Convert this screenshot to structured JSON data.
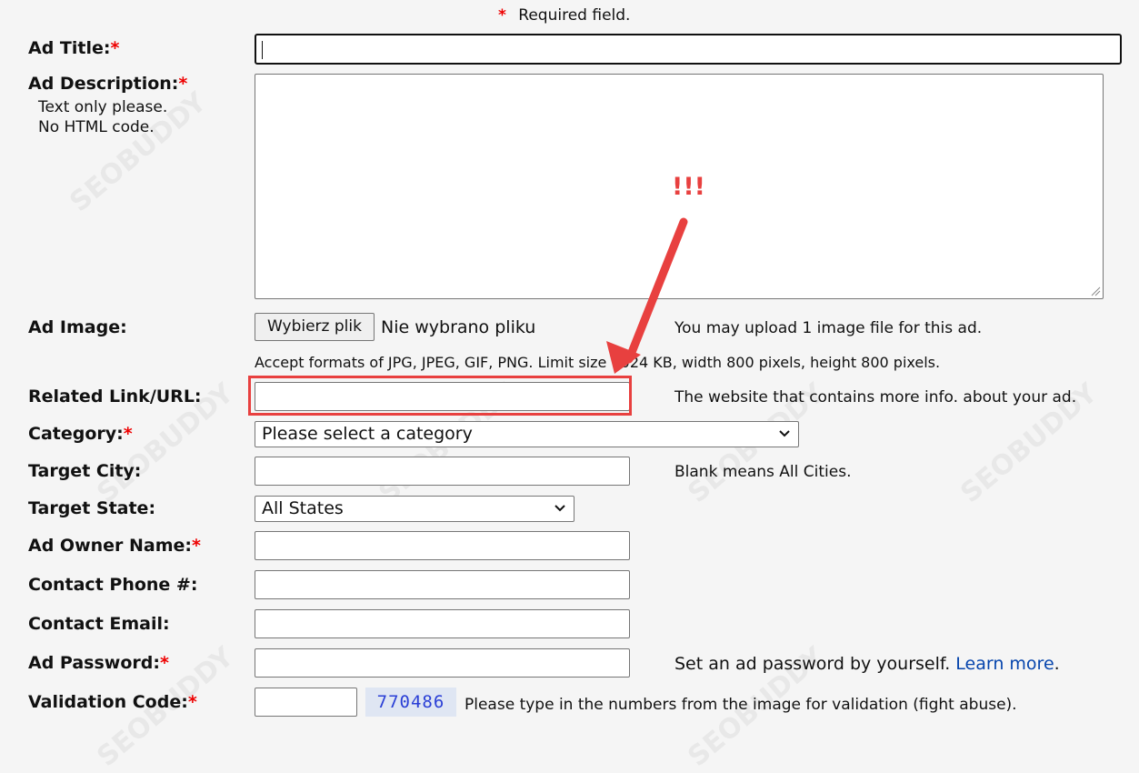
{
  "required_note": {
    "star": "*",
    "text": "Required field."
  },
  "required_star": "*",
  "watermark": {
    "brand": "SEOBUDDY",
    "site": "WWW.SEOBUDDY.COM"
  },
  "fields": {
    "ad_title": {
      "label": "Ad Title:",
      "value": ""
    },
    "ad_description": {
      "label": "Ad Description:",
      "hint1": "Text only please.",
      "hint2": "No HTML code.",
      "value": ""
    },
    "ad_image": {
      "label": "Ad Image:",
      "button": "Wybierz plik",
      "status": "Nie wybrano pliku",
      "note": "You may upload 1 image file for this ad.",
      "formats": "Accept formats of JPG, JPEG, GIF, PNG. Limit size 1024 KB, width 800 pixels, height 800 pixels."
    },
    "related_link": {
      "label": "Related Link/URL:",
      "note": "The website that contains more info. about your ad.",
      "value": ""
    },
    "category": {
      "label": "Category:",
      "selected": "Please select a category"
    },
    "target_city": {
      "label": "Target City:",
      "note": "Blank means All Cities.",
      "value": ""
    },
    "target_state": {
      "label": "Target State:",
      "selected": "All States"
    },
    "ad_owner_name": {
      "label": "Ad Owner Name:",
      "value": ""
    },
    "contact_phone": {
      "label": "Contact Phone #:",
      "value": ""
    },
    "contact_email": {
      "label": "Contact Email:",
      "value": ""
    },
    "ad_password": {
      "label": "Ad Password:",
      "note": "Set an ad password by yourself.",
      "link": "Learn more",
      "value": ""
    },
    "validation_code": {
      "label": "Validation Code:",
      "captcha": "770486",
      "note": "Please type in the numbers from the image for validation (fight abuse).",
      "value": ""
    }
  },
  "annotation": {
    "exclaim": "!!!",
    "color": "#e8403f"
  },
  "colors": {
    "required": "#ee0000",
    "link": "#0645ad",
    "highlight": "#e8403f"
  }
}
